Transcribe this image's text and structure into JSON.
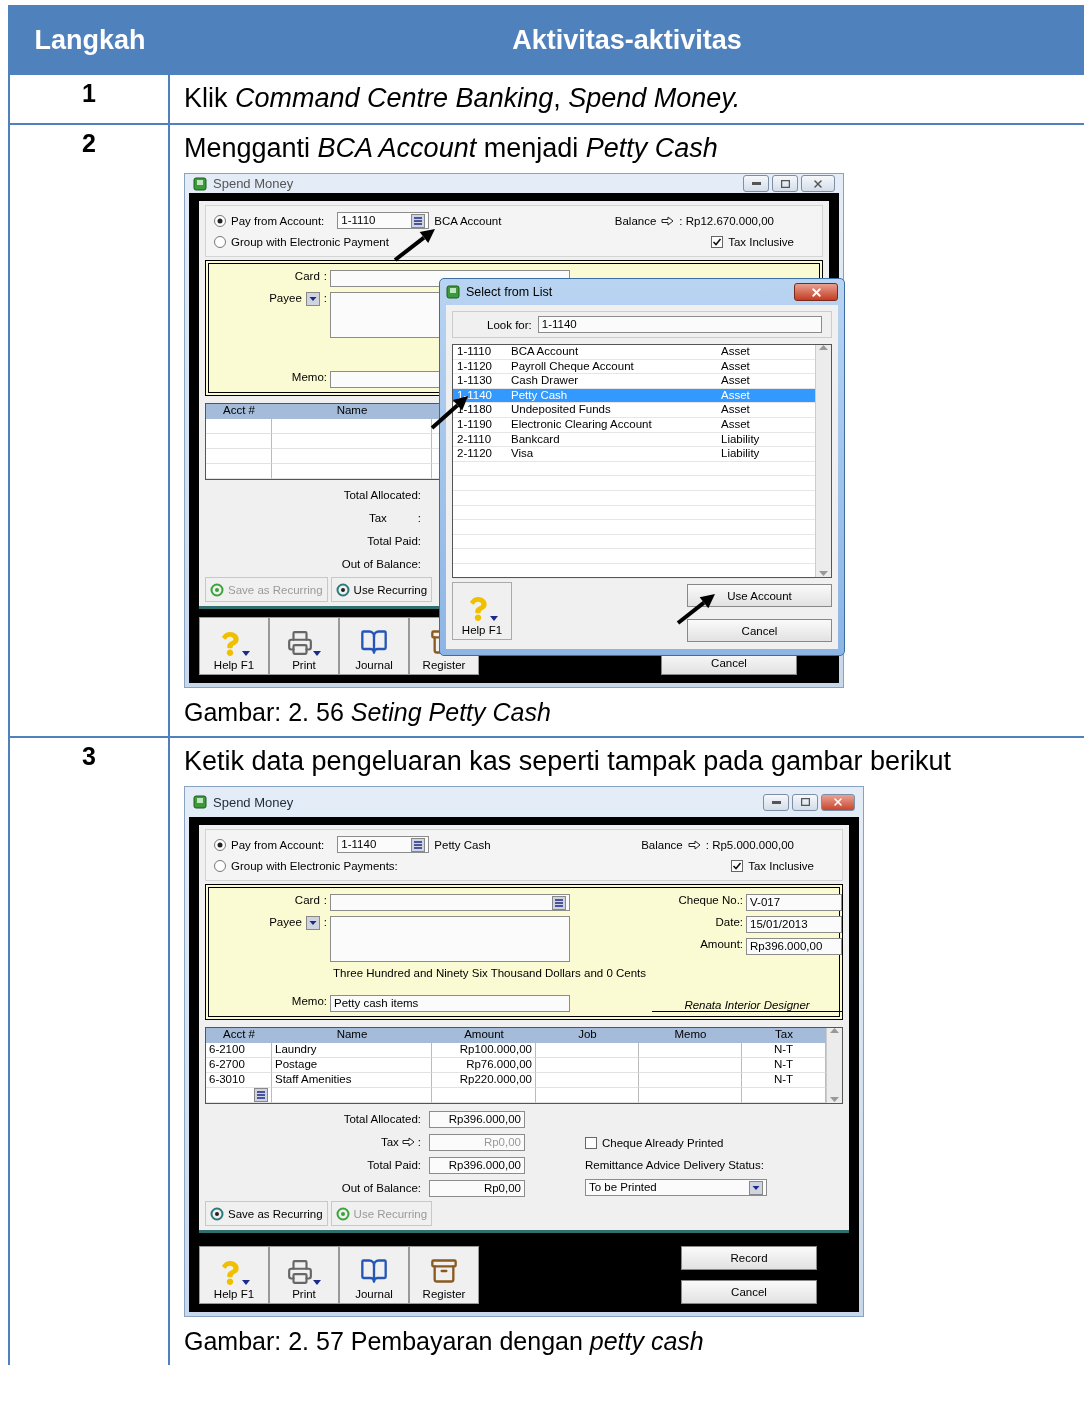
{
  "table": {
    "columns": [
      "Langkah",
      "Aktivitas-aktivitas"
    ],
    "rows": [
      {
        "step": "1",
        "blocks": [
          {
            "kind": "text",
            "text": "Klik *Command Centre Banking*, *Spend Money.*"
          }
        ]
      },
      {
        "step": "2",
        "blocks": [
          {
            "kind": "text",
            "text": "Mengganti *BCA Account* menjadi *Petty Cash*"
          },
          {
            "kind": "window",
            "window": {
              "title": "Spend Money",
              "active": false,
              "pointer_arrows": true,
              "pay_from": {
                "label": "Pay from Account:",
                "selected": true,
                "account": "1-1110",
                "account_name": "BCA Account"
              },
              "group_payments": {
                "label": "Group with Electronic Payment",
                "selected": false
              },
              "balance": {
                "label": "Balance",
                "value": ": Rp12.670.000,00"
              },
              "tax_inclusive": {
                "label": "Tax Inclusive",
                "checked": true
              },
              "cheque": {
                "separator": ":",
                "card_label": "Card",
                "payee_label": "Payee",
                "memo_label": "Memo:"
              },
              "lines": {
                "columns": [
                  "Acct #",
                  "Name"
                ]
              },
              "totals": [
                {
                  "kind": "plain",
                  "label": "Total Allocated:"
                },
                {
                  "kind": "suffixed",
                  "label": "Tax",
                  "suffix": ":"
                },
                {
                  "kind": "plain",
                  "label": "Total Paid:"
                },
                {
                  "kind": "plain",
                  "label": "Out of Balance:"
                }
              ],
              "recurring": [
                {
                  "label": "Save as Recurring",
                  "disabled": true
                },
                {
                  "label": "Use Recurring",
                  "disabled": false
                }
              ],
              "toolbar": [
                {
                  "kind": "help",
                  "label": "Help F1"
                },
                {
                  "kind": "print",
                  "label": "Print"
                },
                {
                  "kind": "journal",
                  "label": "Journal"
                },
                {
                  "kind": "register",
                  "label": "Register"
                }
              ],
              "actions": [
                "Cancel"
              ],
              "dialog": {
                "title": "Select from List",
                "look_for_label": "Look for:",
                "look_for": "1-1140",
                "items": [
                  {
                    "code": "1-1110",
                    "name": "BCA Account",
                    "type": "Asset",
                    "selected": false
                  },
                  {
                    "code": "1-1120",
                    "name": "Payroll Cheque Account",
                    "type": "Asset",
                    "selected": false
                  },
                  {
                    "code": "1-1130",
                    "name": "Cash Drawer",
                    "type": "Asset",
                    "selected": false
                  },
                  {
                    "code": "1-1140",
                    "name": "Petty Cash",
                    "type": "Asset",
                    "selected": true
                  },
                  {
                    "code": "1-1180",
                    "name": "Undeposited Funds",
                    "type": "Asset",
                    "selected": false
                  },
                  {
                    "code": "1-1190",
                    "name": "Electronic Clearing Account",
                    "type": "Asset",
                    "selected": false
                  },
                  {
                    "code": "2-1110",
                    "name": "Bankcard",
                    "type": "Liability",
                    "selected": false
                  },
                  {
                    "code": "2-1120",
                    "name": "Visa",
                    "type": "Liability",
                    "selected": false
                  }
                ],
                "help": "Help F1",
                "buttons": [
                  "Use Account",
                  "Cancel"
                ]
              }
            }
          },
          {
            "kind": "caption",
            "text": "Gambar: 2. 56 *Seting Petty Cash*"
          }
        ]
      },
      {
        "step": "3",
        "blocks": [
          {
            "kind": "text",
            "text": "Ketik data pengeluaran kas seperti tampak pada gambar berikut"
          },
          {
            "kind": "window",
            "window": {
              "title": "Spend Money",
              "active": true,
              "pointer_arrows": false,
              "pay_from": {
                "label": "Pay from Account:",
                "selected": true,
                "account": "1-1140",
                "account_name": "Petty Cash"
              },
              "group_payments": {
                "label": "Group with Electronic Payments:",
                "selected": false
              },
              "balance": {
                "label": "Balance",
                "value": ": Rp5.000.000,00"
              },
              "tax_inclusive": {
                "label": "Tax Inclusive",
                "checked": true
              },
              "cheque": {
                "separator": ":",
                "card_label": "Card",
                "payee_label": "Payee",
                "memo_label": "Memo:",
                "memo": "Petty cash items",
                "cheque_no": {
                  "label": "Cheque No.:",
                  "value": "V-017"
                },
                "date": {
                  "label": "Date:",
                  "value": "15/01/2013"
                },
                "amount": {
                  "label": "Amount:",
                  "value": "Rp396.000,00"
                },
                "amount_words": "Three Hundred and Ninety Six Thousand Dollars and 0 Cents",
                "signature": "Renata Interior Designer"
              },
              "lines": {
                "columns": [
                  "Acct #",
                  "Name",
                  "Amount",
                  "Job",
                  "Memo",
                  "Tax"
                ],
                "rows": [
                  {
                    "acct": "6-2100",
                    "name": "Laundry",
                    "amount": "Rp100.000,00",
                    "tax": "N-T"
                  },
                  {
                    "acct": "6-2700",
                    "name": "Postage",
                    "amount": "Rp76.000,00",
                    "tax": "N-T"
                  },
                  {
                    "acct": "6-3010",
                    "name": "Staff Amenities",
                    "amount": "Rp220.000,00",
                    "tax": "N-T"
                  }
                ]
              },
              "totals": [
                {
                  "kind": "plain",
                  "label": "Total Allocated:",
                  "value": "Rp396.000,00",
                  "dimmed": false
                },
                {
                  "kind": "arrowed",
                  "label": "Tax",
                  "suffix": ":",
                  "value": "Rp0,00",
                  "dimmed": true
                },
                {
                  "kind": "plain",
                  "label": "Total Paid:",
                  "value": "Rp396.000,00",
                  "dimmed": false
                },
                {
                  "kind": "plain",
                  "label": "Out of Balance:",
                  "value": "Rp0,00",
                  "dimmed": false
                }
              ],
              "cheque_printed": {
                "label": "Cheque Already Printed",
                "checked": false
              },
              "remittance": {
                "label": "Remittance Advice Delivery Status:",
                "value": "To be Printed"
              },
              "recurring": [
                {
                  "label": "Save as Recurring",
                  "disabled": false
                },
                {
                  "label": "Use Recurring",
                  "disabled": true
                }
              ],
              "toolbar": [
                {
                  "kind": "help",
                  "label": "Help F1"
                },
                {
                  "kind": "print",
                  "label": "Print"
                },
                {
                  "kind": "journal",
                  "label": "Journal"
                },
                {
                  "kind": "register",
                  "label": "Register"
                }
              ],
              "actions": [
                "Record",
                "Cancel"
              ]
            }
          },
          {
            "kind": "caption",
            "text": "Gambar: 2. 57 Pembayaran dengan *petty cash*"
          }
        ]
      }
    ]
  }
}
